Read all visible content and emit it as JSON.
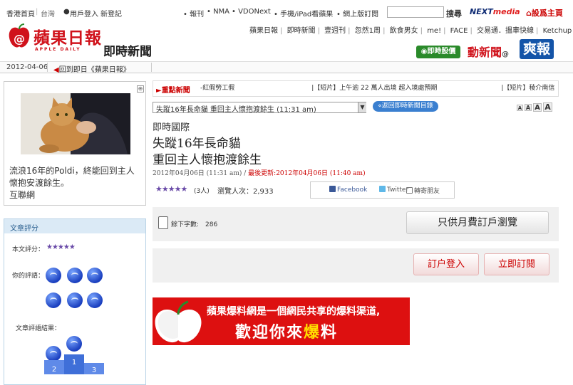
{
  "topbar": {
    "hk_home": "香港首頁",
    "taiwan": "台灣",
    "login": "用戶登入",
    "register": "新登記",
    "links": [
      "報刊",
      "NMA",
      "VDONext",
      "手機/iPad看蘋果",
      "網上版訂閱"
    ],
    "search_placeholder": "",
    "search_label": "搜尋",
    "nextmedia": "NEXTmedia",
    "set_homepage": "設爲主頁"
  },
  "header": {
    "logo_text": "蘋果日報",
    "logo_sub": "APPLE DAILY",
    "section_title": "即時新聞",
    "nav": [
      "蘋果日報",
      "即時新聞",
      "壹週刊",
      "忽然1周",
      "飲食男女",
      "me!",
      "FACE",
      "交易通．搵車快線",
      "Ketchup"
    ],
    "stock_btn": "即時股價",
    "dynamic_news": "動新聞",
    "shuang": "爽報"
  },
  "datebar": {
    "date": "2012-04-06",
    "back_link": "回到即日《蘋果日報》"
  },
  "left": {
    "caption": "流浪16年的Poldi，終能回到主人懷抱安渡餘生。",
    "credit": "互聯網",
    "rating_header": "文章評分",
    "rating_label": "本文評分：",
    "rating_stars": "★★★★★",
    "your_comment": "你的評語：",
    "result_label": "文章評語結果："
  },
  "ticker": {
    "label": "重點新聞",
    "text": "-紅假勞工假　　　　　　　　　　　　|【短片】上午逾 22 萬人出境 超入境處預期　　　　　　　　　　|【短片】稜介南信"
  },
  "article": {
    "select_value": "失蹤16年長命貓 重回主人懷抱渡餘生 (11:31 am)",
    "back_list": "返回即時新聞目錄",
    "font_sizes": [
      "A",
      "A",
      "A",
      "A"
    ],
    "category": "即時國際",
    "headline1": "失蹤16年長命貓",
    "headline2": "重回主人懷抱渡餘生",
    "pubtime": "2012年04月06日 (11:31 am)",
    "updated": "最後更新:2012年04月06日 (11:40 am)",
    "stars": "★★★★★",
    "rating_count": "(3人)",
    "views": "瀏覽人次：2,933",
    "facebook": "Facebook",
    "twitter": "Twitter",
    "forward": "轉寄朋友",
    "word_count": "餘下字數:　286",
    "monthly_btn": "只供月費訂戶瀏覽",
    "login_btn": "訂户登入",
    "subscribe_btn": "立即訂閱"
  },
  "banner": {
    "line1": "蘋果爆料網是一個網民共享的爆料渠道,",
    "line2_a": "歡迎你來",
    "line2_b": "爆",
    "line2_c": "料"
  },
  "colors": {
    "brand_red": "#d0121b",
    "link_blue": "#3a7fd0",
    "rating_purple": "#6a4ba8"
  }
}
